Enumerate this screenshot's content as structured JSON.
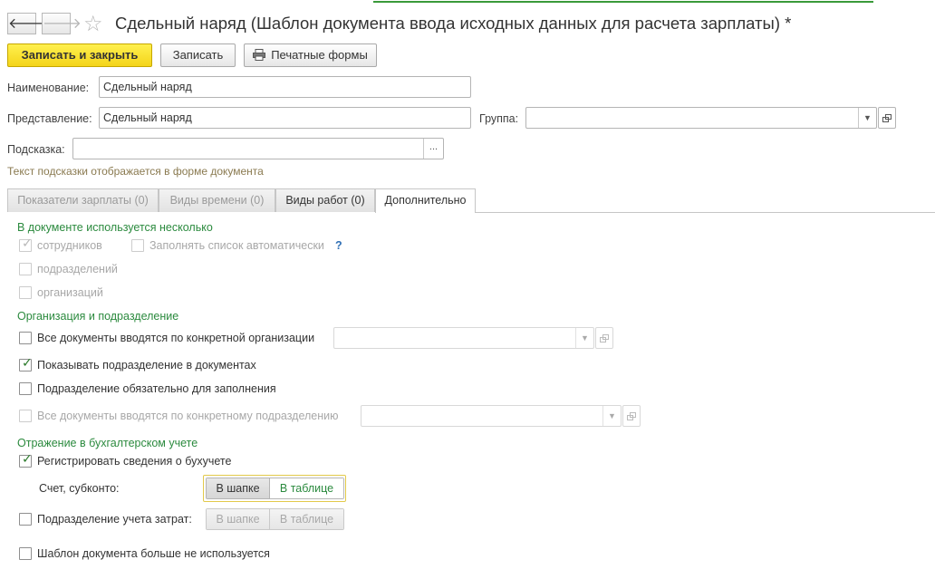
{
  "window": {
    "title": "Сдельный наряд (Шаблон документа ввода исходных данных для расчета зарплаты) *",
    "back_icon": "arrow-left-icon",
    "forward_icon": "arrow-right-icon",
    "favorite_icon": "star-icon"
  },
  "toolbar": {
    "save_close_label": "Записать и закрыть",
    "save_label": "Записать",
    "print_label": "Печатные формы"
  },
  "fields": {
    "name_label": "Наименование:",
    "name_value": "Сдельный наряд",
    "presentation_label": "Представление:",
    "presentation_value": "Сдельный наряд",
    "group_label": "Группа:",
    "group_value": "",
    "hint_label": "Подсказка:",
    "hint_value": "",
    "hint_button": "...",
    "hint_text": "Текст подсказки отображается в форме документа"
  },
  "tabs": [
    {
      "label": "Показатели зарплаты (0)"
    },
    {
      "label": "Виды времени (0)"
    },
    {
      "label": "Виды работ (0)"
    },
    {
      "label": "Дополнительно"
    }
  ],
  "active_tab": "Дополнительно",
  "sections": {
    "multiple": {
      "title": "В документе используется несколько",
      "employees": "сотрудников",
      "fill_auto": "Заполнять список автоматически",
      "help": "?",
      "departments": "подразделений",
      "organizations": "организаций"
    },
    "org": {
      "title": "Организация и подразделение",
      "specific_org": "Все документы вводятся по конкретной организации",
      "show_dept": "Показывать подразделение в документах",
      "dept_required": "Подразделение обязательно для заполнения",
      "specific_dept": "Все документы вводятся по конкретному подразделению"
    },
    "accounting": {
      "title": "Отражение в бухгалтерском учете",
      "register": "Регистрировать сведения о бухучете",
      "account_label": "Счет, субконто:",
      "in_header": "В шапке",
      "in_table": "В таблице",
      "cost_dept": "Подразделение учета затрат:",
      "in_header2": "В шапке",
      "in_table2": "В таблице"
    },
    "unused": "Шаблон документа больше не используется"
  },
  "checkbox_states": {
    "employees": true,
    "fill_auto": false,
    "departments": false,
    "organizations": false,
    "specific_org": false,
    "show_dept": true,
    "dept_required": false,
    "specific_dept": false,
    "register": true,
    "cost_dept": false,
    "unused": false
  },
  "colors": {
    "primary_button": "#f4d41a",
    "section_title": "#2b8a3e",
    "hint_text": "#8a7a50",
    "help_icon": "#2f6fb5"
  }
}
